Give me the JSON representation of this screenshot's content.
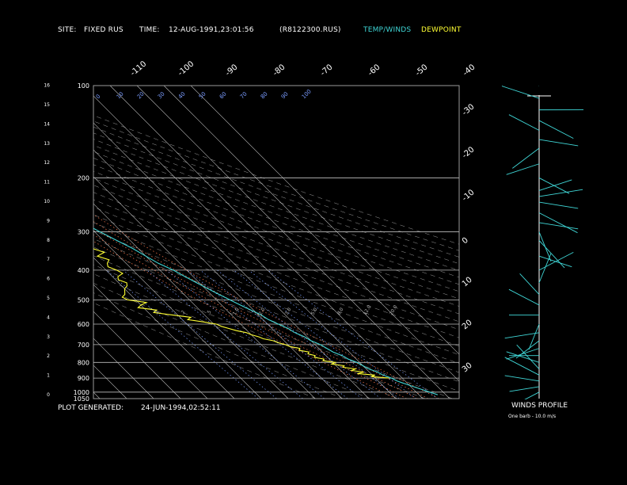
{
  "header": {
    "site_label": "SITE:",
    "site_value": "FIXED RUS",
    "time_label": "TIME:",
    "time_value": "12-AUG-1991,23:01:56",
    "file_value": "(R8122300.RUS)",
    "legend_temp": "TEMP/WINDS",
    "legend_dew": "DEWPOINT"
  },
  "footer": {
    "generated_label": "PLOT GENERATED:",
    "generated_value": "24-JUN-1994,02:52:11",
    "winds_title": "WINDS PROFILE",
    "barb_note": "One barb - 10.0 m/s"
  },
  "colors": {
    "temp": "#3fd6d6",
    "dewpoint": "#ffff33",
    "isotherm": "#bfbfbf",
    "mixing_ratio": "#7a9cff",
    "dry_adiabat": "#e0e0e0",
    "moist_adiabat": "#ff7a4d"
  },
  "chart_data": {
    "type": "line",
    "title": "",
    "pressure_ticks": [
      "100",
      "200",
      "300",
      "400",
      "500",
      "600",
      "700",
      "800",
      "900",
      "1000",
      "1050"
    ],
    "height_ticks": [
      "0",
      "1",
      "2",
      "3",
      "4",
      "5",
      "6",
      "7",
      "8",
      "9",
      "10",
      "11",
      "12",
      "13",
      "14",
      "15",
      "16"
    ],
    "top_temp_labels": [
      "-110",
      "-100",
      "-90",
      "-80",
      "-70",
      "-60",
      "-50",
      "-40"
    ],
    "right_temp_labels": [
      "-30",
      "-20",
      "-10",
      "0",
      "10",
      "20",
      "30"
    ],
    "theta_labels": [
      "0",
      "10",
      "20",
      "30",
      "40",
      "50",
      "60",
      "70",
      "80",
      "90",
      "100"
    ],
    "mixing_labels": [
      ".1",
      ".2",
      ".5",
      "1.0",
      "2.0",
      "3.0",
      "5.0",
      "8.0",
      "12.0",
      "20.0"
    ],
    "series": [
      {
        "key": "temperature",
        "pressure": [
          1020,
          1000,
          980,
          960,
          940,
          920,
          900,
          880,
          860,
          840,
          820,
          800,
          780,
          760,
          740,
          720,
          700,
          680,
          660,
          640,
          620,
          600,
          580,
          560,
          540,
          520,
          500,
          480,
          460,
          440,
          420,
          400,
          380,
          360,
          340,
          320,
          300,
          280,
          260,
          240,
          220,
          210,
          200,
          190,
          180,
          170,
          160,
          150,
          140,
          130,
          120,
          110,
          100
        ],
        "temp": [
          27,
          25,
          23,
          21,
          19,
          17,
          16,
          14,
          13,
          11,
          10,
          9,
          7,
          6,
          4,
          3,
          2,
          0,
          -1,
          -3,
          -4,
          -6,
          -8,
          -9,
          -11,
          -13,
          -15,
          -17,
          -19,
          -21,
          -23,
          -25,
          -28,
          -30,
          -32,
          -35,
          -38,
          -41,
          -44,
          -47,
          -50,
          -52,
          -53,
          -54,
          -56,
          -57,
          -58,
          -58,
          -59,
          -59,
          -60,
          -61,
          -61
        ]
      },
      {
        "key": "dewpoint",
        "pressure": [
          900,
          890,
          880,
          870,
          860,
          850,
          840,
          830,
          820,
          810,
          800,
          790,
          780,
          770,
          760,
          750,
          740,
          730,
          720,
          710,
          700,
          690,
          680,
          670,
          660,
          650,
          640,
          630,
          620,
          610,
          600,
          590,
          580,
          570,
          560,
          550,
          540,
          530,
          520,
          510,
          500,
          490,
          480,
          470,
          460,
          450,
          440,
          430,
          420,
          410,
          400,
          390,
          380,
          370,
          360,
          350,
          340,
          330,
          320,
          310,
          300,
          290,
          280,
          270,
          260,
          250,
          240,
          230,
          220,
          210,
          200
        ],
        "temp": [
          15,
          9,
          11,
          5,
          8,
          4,
          6,
          2,
          3,
          -1,
          1,
          -3,
          -2,
          -5,
          -4,
          -6,
          -5,
          -8,
          -7,
          -10,
          -11,
          -13,
          -14,
          -17,
          -18,
          -20,
          -21,
          -24,
          -26,
          -28,
          -29,
          -33,
          -38,
          -36,
          -42,
          -48,
          -46,
          -52,
          -50,
          -47,
          -53,
          -54,
          -52,
          -51,
          -50,
          -48,
          -47,
          -49,
          -48,
          -45,
          -46,
          -48,
          -47,
          -45,
          -48,
          -44,
          -47,
          -46,
          -49,
          -48,
          -51,
          -47,
          -48,
          -52,
          -50,
          -55,
          -54,
          -58,
          -53,
          -52,
          -54
        ]
      }
    ],
    "winds": [
      {
        "pressure": 1000,
        "dir": 240,
        "speed": 10
      },
      {
        "pressure": 960,
        "dir": 260,
        "speed": 15
      },
      {
        "pressure": 920,
        "dir": 280,
        "speed": 20
      },
      {
        "pressure": 880,
        "dir": 300,
        "speed": 25
      },
      {
        "pressure": 840,
        "dir": 320,
        "speed": 20
      },
      {
        "pressure": 800,
        "dir": 290,
        "speed": 20
      },
      {
        "pressure": 760,
        "dir": 270,
        "speed": 15
      },
      {
        "pressure": 720,
        "dir": 250,
        "speed": 20
      },
      {
        "pressure": 680,
        "dir": 230,
        "speed": 15
      },
      {
        "pressure": 640,
        "dir": 260,
        "speed": 20
      },
      {
        "pressure": 600,
        "dir": 200,
        "speed": 15
      },
      {
        "pressure": 560,
        "dir": 270,
        "speed": 15
      },
      {
        "pressure": 520,
        "dir": 300,
        "speed": 20
      },
      {
        "pressure": 480,
        "dir": 320,
        "speed": 15
      },
      {
        "pressure": 440,
        "dir": 20,
        "speed": 20
      },
      {
        "pressure": 400,
        "dir": 60,
        "speed": 25
      },
      {
        "pressure": 360,
        "dir": 110,
        "speed": 20
      },
      {
        "pressure": 320,
        "dir": 140,
        "speed": 25
      },
      {
        "pressure": 300,
        "dir": 160,
        "speed": 20
      },
      {
        "pressure": 280,
        "dir": 100,
        "speed": 25
      },
      {
        "pressure": 260,
        "dir": 120,
        "speed": 30
      },
      {
        "pressure": 240,
        "dir": 100,
        "speed": 25
      },
      {
        "pressure": 230,
        "dir": 80,
        "speed": 30
      },
      {
        "pressure": 220,
        "dir": 70,
        "speed": 20
      },
      {
        "pressure": 200,
        "dir": 120,
        "speed": 20
      },
      {
        "pressure": 180,
        "dir": 250,
        "speed": 20
      },
      {
        "pressure": 160,
        "dir": 230,
        "speed": 20
      },
      {
        "pressure": 150,
        "dir": 100,
        "speed": 25
      },
      {
        "pressure": 140,
        "dir": 300,
        "speed": 20
      },
      {
        "pressure": 130,
        "dir": 120,
        "speed": 25
      },
      {
        "pressure": 120,
        "dir": 90,
        "speed": 30
      },
      {
        "pressure": 110,
        "dir": 290,
        "speed": 25
      },
      {
        "pressure": 100,
        "dir": 300,
        "speed": 20
      }
    ]
  }
}
